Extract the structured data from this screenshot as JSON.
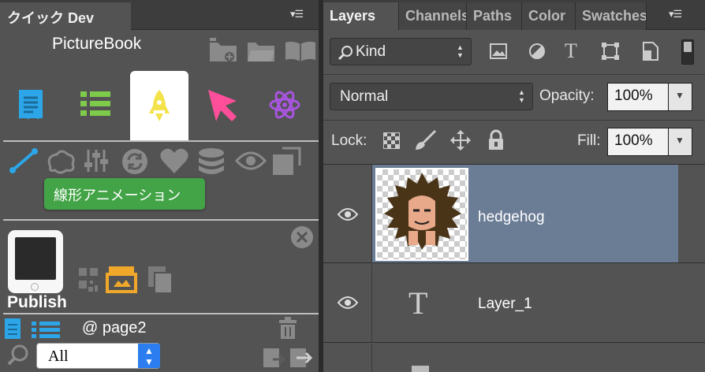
{
  "left_panel": {
    "tab_title": "クイック Dev",
    "app_title": "PictureBook",
    "tooltip": "線形アニメーション",
    "publish_label": "Publish",
    "page_label": "@ page2",
    "filter_value": "All",
    "colors": {
      "blue": "#2ca6e8",
      "green": "#7ecb4b",
      "yellow": "#f4e24a",
      "pink": "#ff4f9a",
      "purple": "#a855e0",
      "tooltip_green": "#43a447"
    }
  },
  "right_panel": {
    "tabs": [
      "Layers",
      "Channels",
      "Paths",
      "Color",
      "Swatches"
    ],
    "filter_kind": "Kind",
    "blend_mode": "Normal",
    "opacity_label": "Opacity:",
    "opacity_value": "100%",
    "lock_label": "Lock:",
    "fill_label": "Fill:",
    "fill_value": "100%",
    "layers": [
      {
        "name": "hedgehog",
        "type": "image",
        "selected": true
      },
      {
        "name": "Layer_1",
        "type": "text",
        "selected": false
      }
    ],
    "colors": {
      "selected_row": "#6b7c95"
    }
  }
}
